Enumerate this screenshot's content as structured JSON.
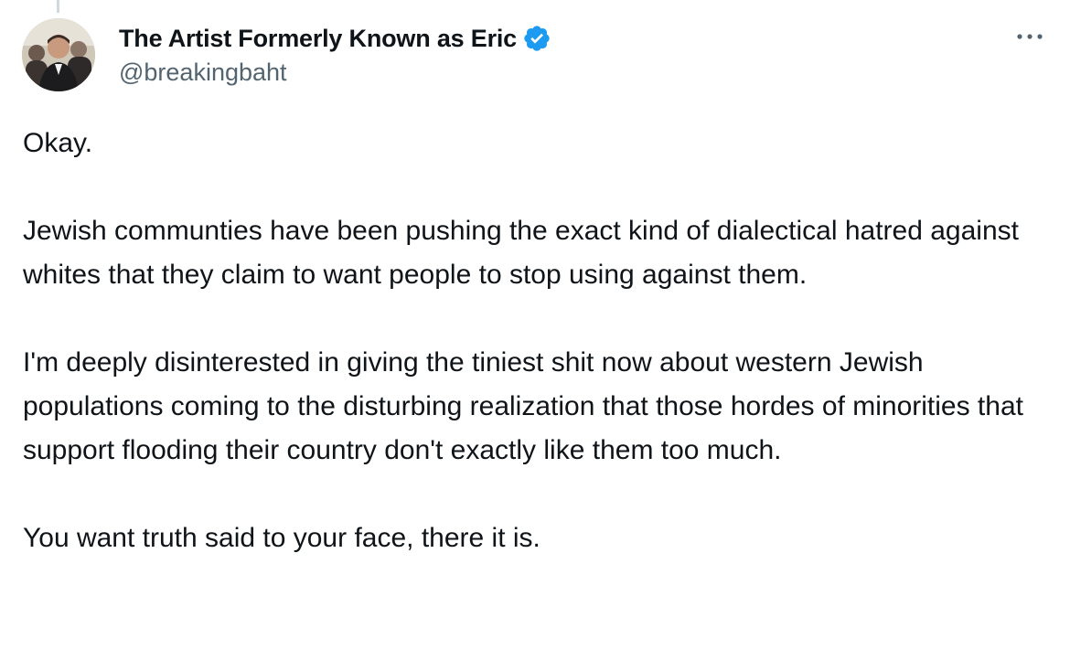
{
  "tweet": {
    "author": {
      "display_name": "The Artist Formerly Known as Eric",
      "handle": "@breakingbaht",
      "verified_icon": "verified-badge-icon",
      "verified_color": "#1d9bf0"
    },
    "more_icon": "more-horizontal-icon",
    "paragraphs": [
      "Okay.",
      "Jewish communties have been pushing the exact kind of dialectical hatred against whites that they claim to want people to stop using against them.",
      "I'm deeply disinterested in giving the tiniest shit now about western Jewish populations coming to the disturbing realization that those hordes of minorities that support flooding their country don't exactly like them too much.",
      "You want truth said to your face, there it is."
    ]
  },
  "colors": {
    "text_primary": "#0f1419",
    "text_secondary": "#536471",
    "thread_line": "#cfd9de"
  }
}
